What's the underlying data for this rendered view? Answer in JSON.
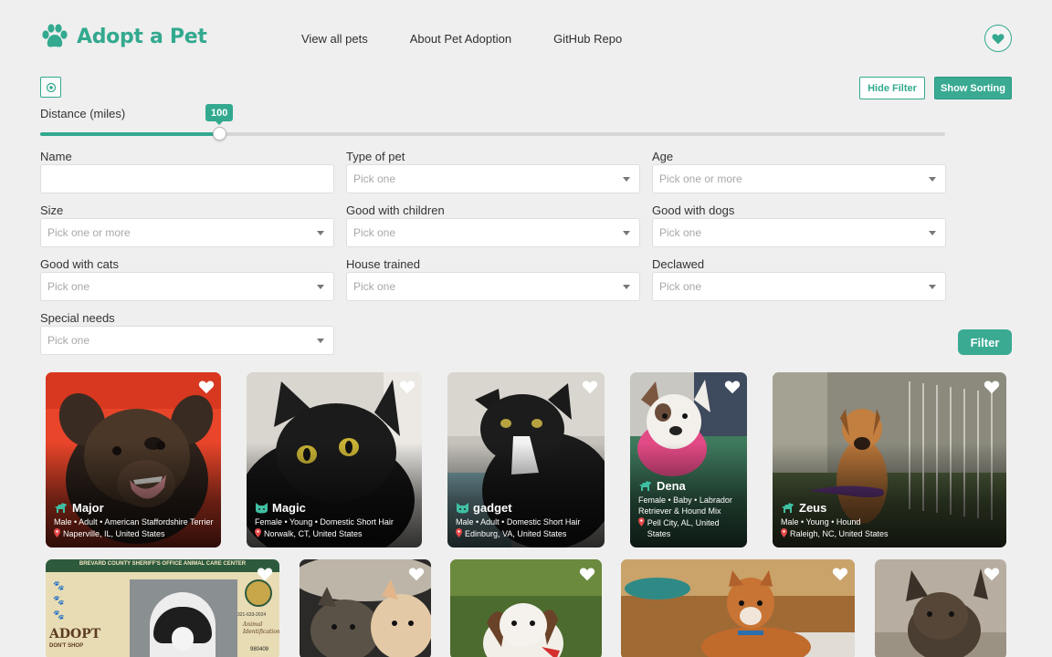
{
  "header": {
    "logo_text": "Adopt a Pet",
    "nav": [
      "View all pets",
      "About Pet Adoption",
      "GitHub Repo"
    ]
  },
  "toolbar": {
    "hide_filter_label": "Hide Filter",
    "show_sorting_label": "Show Sorting"
  },
  "distance": {
    "label": "Distance (miles)",
    "value": "100",
    "fill_fraction": 0.198
  },
  "filters": [
    {
      "label": "Name",
      "placeholder": ""
    },
    {
      "label": "Type of pet",
      "placeholder": "Pick one"
    },
    {
      "label": "Age",
      "placeholder": "Pick one or more"
    },
    {
      "label": "Size",
      "placeholder": "Pick one or more"
    },
    {
      "label": "Good with children",
      "placeholder": "Pick one"
    },
    {
      "label": "Good with dogs",
      "placeholder": "Pick one"
    },
    {
      "label": "Good with cats",
      "placeholder": "Pick one"
    },
    {
      "label": "House trained",
      "placeholder": "Pick one"
    },
    {
      "label": "Declawed",
      "placeholder": "Pick one"
    },
    {
      "label": "Special needs",
      "placeholder": "Pick one"
    }
  ],
  "filter_button_label": "Filter",
  "pets": [
    {
      "name": "Major",
      "species": "dog",
      "meta": "Male • Adult • American Staffordshire Terrier",
      "location": "Naperville, IL, United States"
    },
    {
      "name": "Magic",
      "species": "cat",
      "meta": "Female • Young • Domestic Short Hair",
      "location": "Norwalk, CT, United States"
    },
    {
      "name": "gadget",
      "species": "cat",
      "meta": "Male • Adult • Domestic Short Hair",
      "location": "Edinburg, VA, United States"
    },
    {
      "name": "Dena",
      "species": "dog",
      "meta": "Female • Baby • Labrador Retriever & Hound Mix",
      "location": "Pell City, AL, United States"
    },
    {
      "name": "Zeus",
      "species": "dog",
      "meta": "Male • Young • Hound",
      "location": "Raleigh, NC, United States"
    }
  ],
  "partial_cards": {
    "card1_banner": "BREVARD COUNTY SHERIFF'S OFFICE ANIMAL CARE CENTER",
    "card1_side_text": "ADOPT",
    "card1_side_text2": "DON'T SHOP",
    "card1_phone": "321-633-2024",
    "card1_id_label": "Animal Identification",
    "card1_id": "980409"
  },
  "colors": {
    "brand": "#33a98f",
    "background": "#efefef"
  }
}
